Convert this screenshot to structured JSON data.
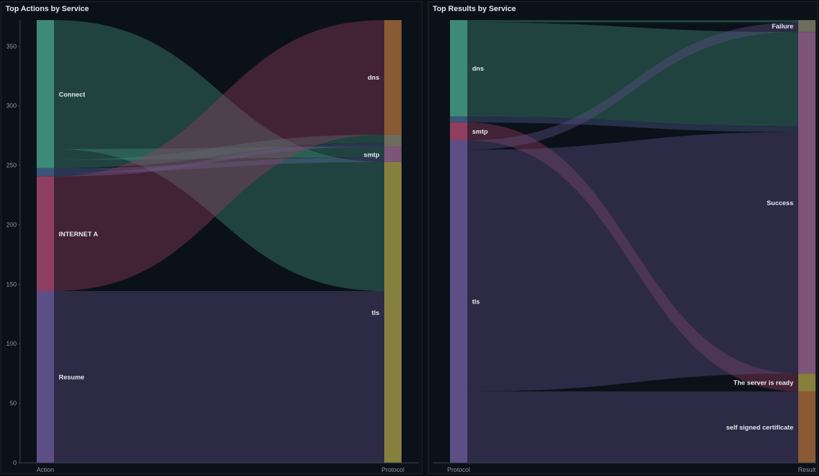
{
  "panels": [
    {
      "title": "Top Actions by Service"
    },
    {
      "title": "Top Results by Service"
    }
  ],
  "chart_data": [
    {
      "type": "sankey",
      "title": "Top Actions by Service",
      "y_ticks": [
        0,
        50,
        100,
        150,
        200,
        250,
        300,
        350
      ],
      "ylim": [
        0,
        372
      ],
      "column_labels": [
        "Action",
        "Protocol"
      ],
      "left_nodes": [
        {
          "id": "connect",
          "label": "Connect",
          "color": "#3d8a78"
        },
        {
          "id": "_gap",
          "label": "",
          "color": "#3a5577"
        },
        {
          "id": "internet",
          "label": "INTERNET A",
          "color": "#8e3f5f"
        },
        {
          "id": "resume",
          "label": "Resume",
          "color": "#5c4f86"
        }
      ],
      "right_nodes": [
        {
          "id": "dns",
          "label": "dns",
          "color": "#8a5a34"
        },
        {
          "id": "_gap",
          "label": "",
          "color": "#6d6d5c"
        },
        {
          "id": "smtp",
          "label": "smtp",
          "color": "#7c5579"
        },
        {
          "id": "tls",
          "label": "tls",
          "color": "#86803f"
        }
      ],
      "links": [
        {
          "source": "connect",
          "target": "tls",
          "value": 108,
          "color": "#3d8a78"
        },
        {
          "source": "connect",
          "target": "smtp",
          "value": 9,
          "color": "#3d8a78"
        },
        {
          "source": "connect",
          "target": "_gap",
          "value": 7,
          "color": "#3d8a78"
        },
        {
          "source": "_gap",
          "target": "smtp",
          "value": 4,
          "color": "#5a6aa0"
        },
        {
          "source": "_gap",
          "target": "_gap",
          "value": 3,
          "color": "#5a6aa0"
        },
        {
          "source": "internet",
          "target": "dns",
          "value": 96,
          "color": "#8e3f5f"
        },
        {
          "source": "resume",
          "target": "tls",
          "value": 144,
          "color": "#5c4f86"
        }
      ]
    },
    {
      "type": "sankey",
      "title": "Top Results by Service",
      "column_labels": [
        "Protocol",
        "Result"
      ],
      "left_nodes": [
        {
          "id": "dns",
          "label": "dns",
          "color": "#3d8a78"
        },
        {
          "id": "_gap",
          "label": "",
          "color": "#3a5577"
        },
        {
          "id": "smtp",
          "label": "smtp",
          "color": "#8e3f5f"
        },
        {
          "id": "tls",
          "label": "tls",
          "color": "#5c4f86"
        }
      ],
      "right_nodes": [
        {
          "id": "failure",
          "label": "Failure",
          "color": "#6d6d5c"
        },
        {
          "id": "success",
          "label": "Success",
          "color": "#7c5579"
        },
        {
          "id": "ready",
          "label": "The server is ready",
          "color": "#86803f"
        },
        {
          "id": "selfsigned",
          "label": "self signed certificate",
          "color": "#8a5a34"
        }
      ],
      "links": [
        {
          "source": "dns",
          "target": "failure",
          "value": 2,
          "color": "#3d8a78"
        },
        {
          "source": "dns",
          "target": "success",
          "value": 79,
          "color": "#3d8a78"
        },
        {
          "source": "_gap",
          "target": "success",
          "value": 5,
          "color": "#4a5a8a"
        },
        {
          "source": "smtp",
          "target": "ready",
          "value": 15,
          "color": "#8e3f5f"
        },
        {
          "source": "tls",
          "target": "failure",
          "value": 8,
          "color": "#5c4f86"
        },
        {
          "source": "tls",
          "target": "success",
          "value": 203,
          "color": "#5c4f86"
        },
        {
          "source": "tls",
          "target": "ready",
          "value": 0,
          "color": "#5c4f86"
        },
        {
          "source": "tls",
          "target": "selfsigned",
          "value": 60,
          "color": "#5c4f86"
        }
      ]
    }
  ]
}
